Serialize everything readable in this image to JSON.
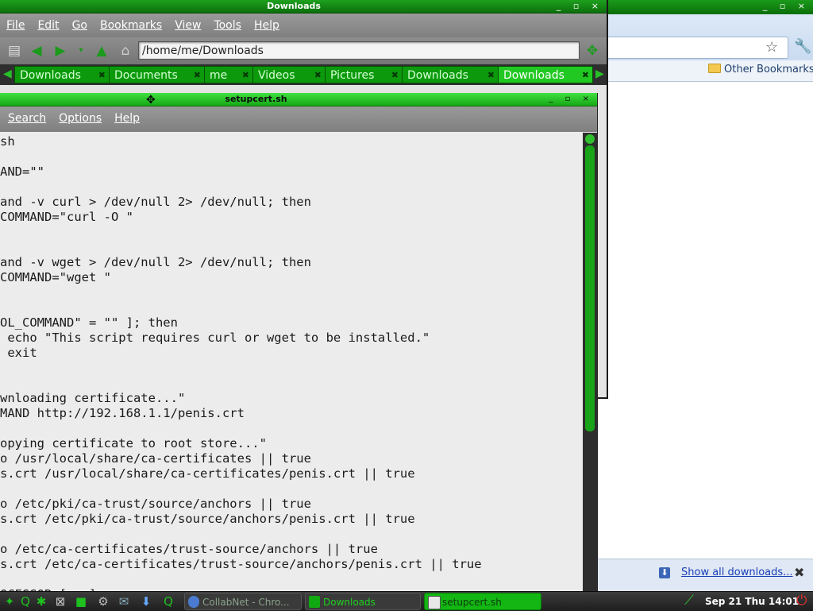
{
  "chrome": {
    "other_bookmarks": "Other Bookmarks",
    "show_all_downloads": "Show all downloads...",
    "window_buttons": "_ ▫ ×"
  },
  "file_manager": {
    "title": "Downloads",
    "window_buttons": "_ ▫ ×",
    "menu": [
      "File",
      "Edit",
      "Go",
      "Bookmarks",
      "View",
      "Tools",
      "Help"
    ],
    "location": "/home/me/Downloads",
    "tabs": [
      {
        "label": "Downloads",
        "active": false
      },
      {
        "label": "Documents",
        "active": false
      },
      {
        "label": "me",
        "active": false
      },
      {
        "label": "Videos",
        "active": false
      },
      {
        "label": "Pictures",
        "active": false
      },
      {
        "label": "Downloads",
        "active": false
      },
      {
        "label": "Downloads",
        "active": true
      }
    ]
  },
  "editor": {
    "title": "setupcert.sh",
    "window_buttons": "_ ▫ ×",
    "menu": [
      "Search",
      "Options",
      "Help"
    ],
    "content": "sh\n\nAND=\"\"\n\nand -v curl > /dev/null 2> /dev/null; then\nCOMMAND=\"curl -O \"\n\n\nand -v wget > /dev/null 2> /dev/null; then\nCOMMAND=\"wget \"\n\n\nOL_COMMAND\" = \"\" ]; then\n echo \"This script requires curl or wget to be installed.\"\n exit\n\n\nwnloading certificate...\"\nMAND http://192.168.1.1/penis.crt\n\nopying certificate to root store...\"\no /usr/local/share/ca-certificates || true\ns.crt /usr/local/share/ca-certificates/penis.crt || true\n\no /etc/pki/ca-trust/source/anchors || true\ns.crt /etc/pki/ca-trust/source/anchors/penis.crt || true\n\no /etc/ca-certificates/trust-source/anchors || true\ns.crt /etc/ca-certificates/trust-source/anchors/penis.crt || true\n\nOCESSOR [...]"
  },
  "taskbar": {
    "tasks": [
      {
        "label": "CollabNet - Chro...",
        "icon": "chrome-icon"
      },
      {
        "label": "Downloads",
        "icon": "folder-icon"
      },
      {
        "label": "setupcert.sh",
        "icon": "text-editor-icon"
      }
    ],
    "clock": "Sep 21 Thu 14:01"
  },
  "colors": {
    "titlebar_green": "#16a816",
    "tab_green": "#0c9a0c",
    "active_task_green": "#13b613",
    "menubar_gray": "#8a8a8a"
  }
}
